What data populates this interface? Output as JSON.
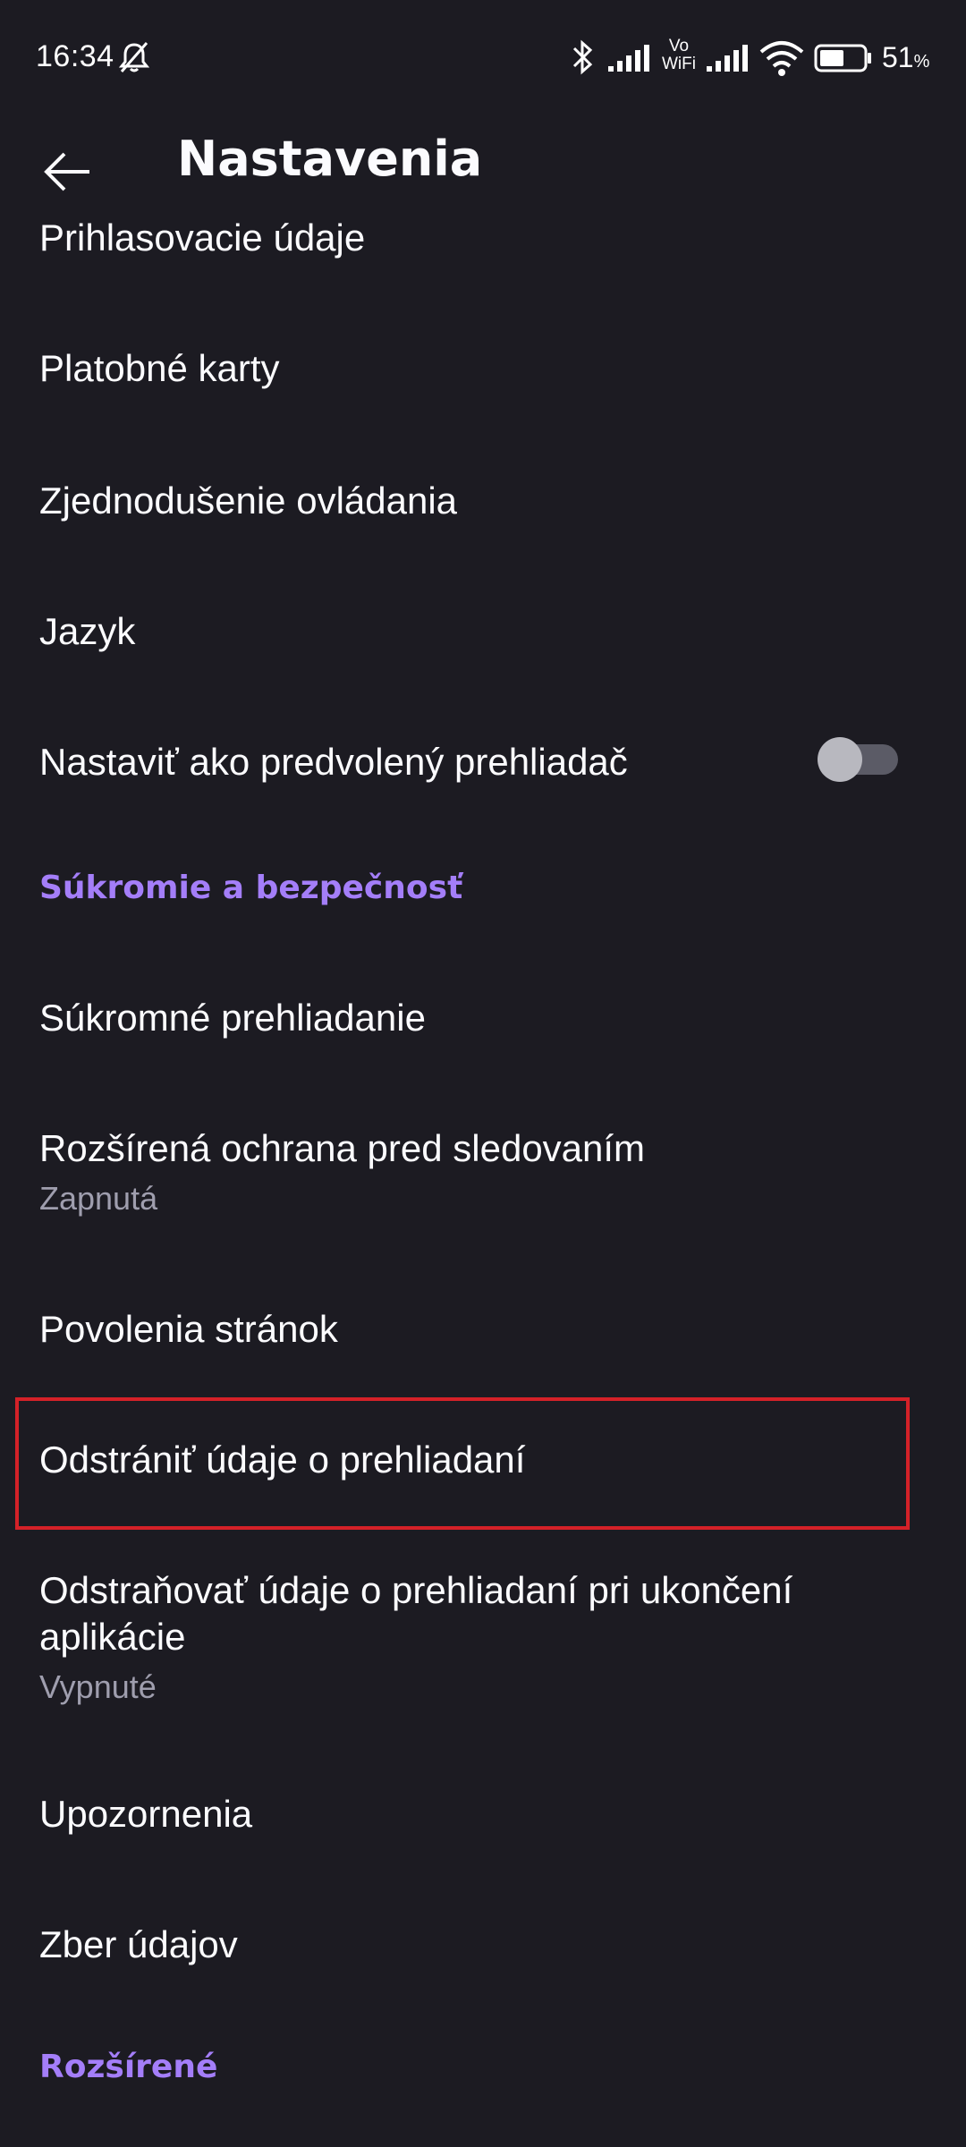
{
  "status_bar": {
    "time": "16:34",
    "vowifi": "Vo\nWiFi",
    "battery": "51",
    "battery_unit": "%"
  },
  "toolbar": {
    "back_label": "Back",
    "title": "Nastavenia"
  },
  "items": [
    {
      "title": "Prihlasovacie údaje"
    },
    {
      "title": "Platobné karty"
    },
    {
      "title": "Zjednodušenie ovládania"
    },
    {
      "title": "Jazyk"
    },
    {
      "title": "Nastaviť ako predvolený prehliadač",
      "toggle": false
    },
    {
      "title": "Súkromné prehliadanie"
    },
    {
      "title": "Rozšírená ochrana pred sledovaním",
      "summary": "Zapnutá"
    },
    {
      "title": "Povolenia stránok"
    },
    {
      "title": "Odstrániť údaje o prehliadaní",
      "highlighted": true
    },
    {
      "title": "Odstraňovať údaje o prehliadaní pri ukončení aplikácie",
      "summary": "Vypnuté"
    },
    {
      "title": "Upozornenia"
    },
    {
      "title": "Zber údajov"
    }
  ],
  "sections": {
    "privacy": "Súkromie a bezpečnosť",
    "advanced": "Rozšírené"
  },
  "colors": {
    "background": "#1c1b22",
    "accent": "#a47ef9",
    "highlight": "#d42128"
  }
}
